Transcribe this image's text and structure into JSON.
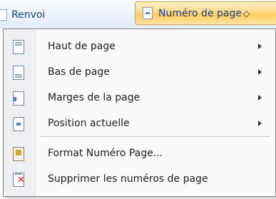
{
  "ribbon": {
    "renvoi_label": "Renvoi",
    "numero_label": "Numéro de page",
    "numero_caret": "◇"
  },
  "menu": {
    "items": [
      {
        "label": "Haut de page",
        "has_submenu": true,
        "icon": "page-top-icon"
      },
      {
        "label": "Bas de page",
        "has_submenu": true,
        "icon": "page-bottom-icon"
      },
      {
        "label": "Marges de la page",
        "has_submenu": true,
        "icon": "page-margins-icon"
      },
      {
        "label": "Position actuelle",
        "has_submenu": true,
        "icon": "current-position-icon"
      },
      {
        "label": "Format Numéro Page...",
        "has_submenu": false,
        "icon": "format-page-number-icon"
      },
      {
        "label": "Supprimer les numéros de page",
        "has_submenu": false,
        "icon": "remove-page-numbers-icon"
      }
    ]
  },
  "colors": {
    "accent_text": "#15428b",
    "highlight": "#ffcb5c",
    "remove_icon": "#d81a1a"
  }
}
